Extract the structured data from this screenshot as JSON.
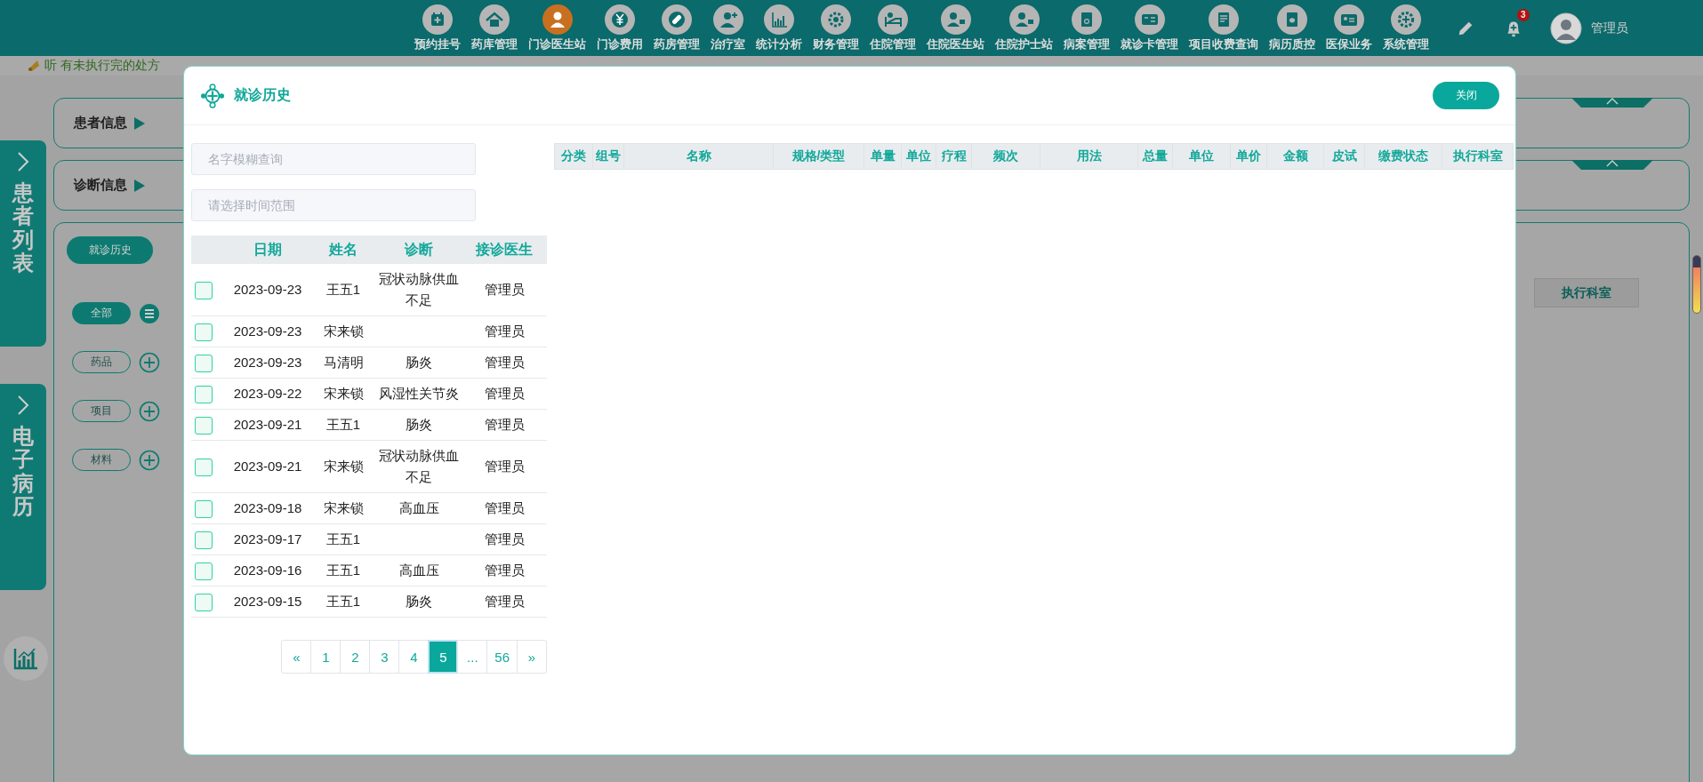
{
  "top_bar": {
    "nav_items": [
      {
        "label": "预约挂号",
        "selected": false
      },
      {
        "label": "药库管理",
        "selected": false
      },
      {
        "label": "门诊医生站",
        "selected": true
      },
      {
        "label": "门诊费用",
        "selected": false
      },
      {
        "label": "药房管理",
        "selected": false
      },
      {
        "label": "治疗室",
        "selected": false
      },
      {
        "label": "统计分析",
        "selected": false
      },
      {
        "label": "财务管理",
        "selected": false
      },
      {
        "label": "住院管理",
        "selected": false
      },
      {
        "label": "住院医生站",
        "selected": false
      },
      {
        "label": "住院护士站",
        "selected": false
      },
      {
        "label": "病案管理",
        "selected": false
      },
      {
        "label": "就诊卡管理",
        "selected": false
      },
      {
        "label": "项目收费查询",
        "selected": false
      },
      {
        "label": "病历质控",
        "selected": false
      },
      {
        "label": "医保业务",
        "selected": false
      },
      {
        "label": "系统管理",
        "selected": false
      }
    ],
    "notification_count": "3",
    "user_name": "管理员"
  },
  "ticker": {
    "message": "听 有未执行完的处方"
  },
  "side_tabs": [
    {
      "label": "患者列表"
    },
    {
      "label": "电子病历"
    }
  ],
  "patient_info": {
    "title": "患者信息"
  },
  "diagnosis_info": {
    "title": "诊断信息"
  },
  "workspace": {
    "buttons": [
      "就诊历史"
    ],
    "filters": [
      {
        "label": "全部",
        "selected": true
      },
      {
        "label": "药品",
        "selected": false
      },
      {
        "label": "项目",
        "selected": false
      },
      {
        "label": "材料",
        "selected": false
      }
    ],
    "table_columns": [
      "执行科室"
    ]
  },
  "dialog": {
    "title": "就诊历史",
    "close_button": "关闭",
    "name_search": {
      "placeholder": "名字模糊查询"
    },
    "date_range": {
      "placeholder": "请选择时间范围"
    },
    "visits": {
      "columns": [
        "日期",
        "姓名",
        "诊断",
        "接诊医生"
      ],
      "rows": [
        {
          "checked": false,
          "date": "2023-09-23",
          "name": "王五1",
          "diagnosis": "冠状动脉供血不足",
          "doctor": "管理员"
        },
        {
          "checked": false,
          "date": "2023-09-23",
          "name": "宋来锁",
          "doctor": "管理员"
        },
        {
          "checked": false,
          "date": "2023-09-23",
          "name": "马清明",
          "diagnosis": "肠炎",
          "doctor": "管理员"
        },
        {
          "checked": false,
          "date": "2023-09-22",
          "name": "宋来锁",
          "diagnosis": "风湿性关节炎",
          "doctor": "管理员"
        },
        {
          "checked": false,
          "date": "2023-09-21",
          "name": "王五1",
          "diagnosis": "肠炎",
          "doctor": "管理员"
        },
        {
          "checked": false,
          "date": "2023-09-21",
          "name": "宋来锁",
          "diagnosis": "冠状动脉供血不足",
          "doctor": "管理员"
        },
        {
          "checked": false,
          "date": "2023-09-18",
          "name": "宋来锁",
          "diagnosis": "高血压",
          "doctor": "管理员"
        },
        {
          "checked": false,
          "date": "2023-09-17",
          "name": "王五1",
          "doctor": "管理员"
        },
        {
          "checked": false,
          "date": "2023-09-16",
          "name": "王五1",
          "diagnosis": "高血压",
          "doctor": "管理员"
        },
        {
          "checked": false,
          "date": "2023-09-15",
          "name": "王五1",
          "diagnosis": "肠炎",
          "doctor": "管理员"
        }
      ]
    },
    "pagination": [
      {
        "label": "«",
        "selected": false
      },
      {
        "label": "1",
        "selected": false
      },
      {
        "label": "2",
        "selected": false
      },
      {
        "label": "3",
        "selected": false
      },
      {
        "label": "4",
        "selected": false
      },
      {
        "label": "5",
        "selected": true
      },
      {
        "label": "...",
        "selected": false
      },
      {
        "label": "56",
        "selected": false
      },
      {
        "label": "»",
        "selected": false
      }
    ],
    "orders": {
      "columns": [
        "分类",
        "组号",
        "名称",
        "规格/类型",
        "单量",
        "单位",
        "疗程",
        "频次",
        "用法",
        "总量",
        "单位",
        "单价",
        "金额",
        "皮试",
        "缴费状态",
        "执行科室"
      ]
    }
  }
}
